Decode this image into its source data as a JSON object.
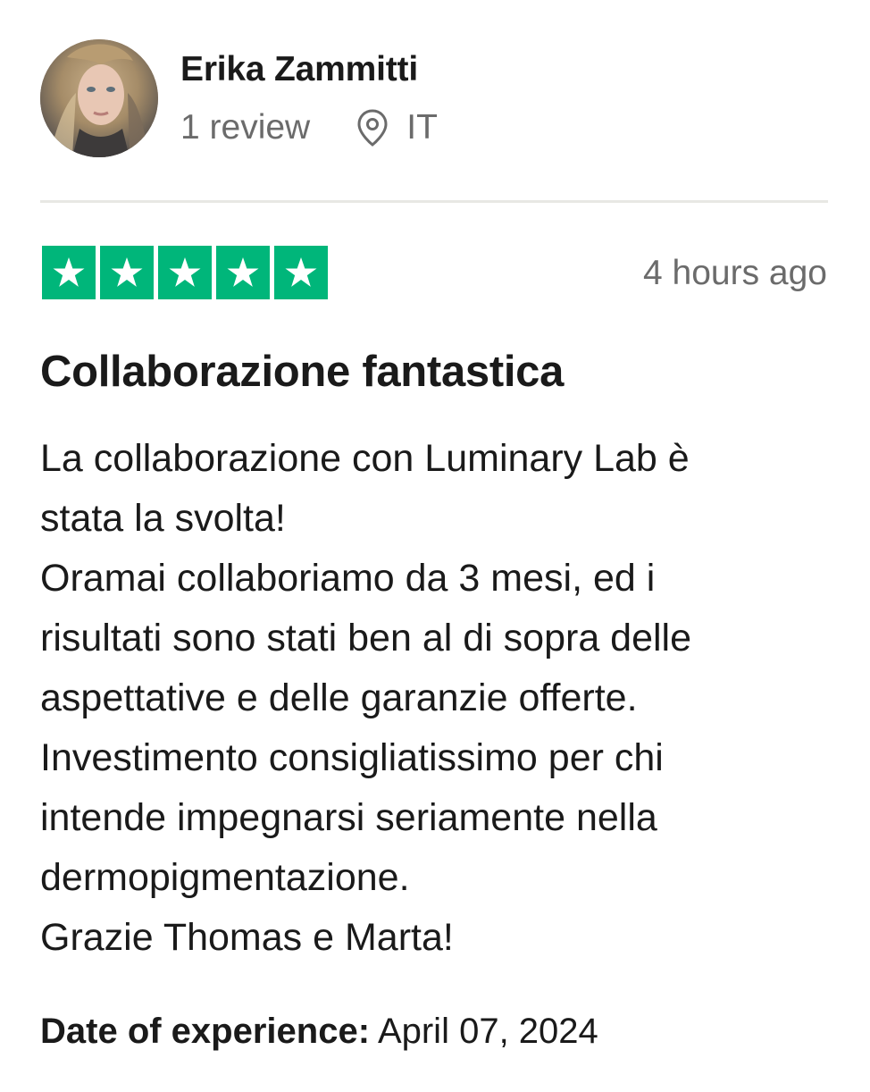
{
  "reviewer": {
    "name": "Erika Zammitti",
    "review_count": "1 review",
    "country": "IT",
    "location_icon": "location-pin-icon",
    "avatar_icon": "user-avatar"
  },
  "review": {
    "rating": 5,
    "max_rating": 5,
    "star_color": "#00b67a",
    "timestamp": "4 hours ago",
    "title": "Collaborazione fantastica",
    "body": "La collaborazione con Luminary Lab è\nstata la svolta!\nOramai collaboriamo da 3 mesi, ed i\nrisultati sono stati ben al di sopra delle\naspettative e delle garanzie offerte.\nInvestimento consigliatissimo per chi\nintende impegnarsi seriamente nella\ndermopigmentazione.\nGrazie Thomas e Marta!",
    "experience_label": "Date of experience:",
    "experience_date": "April 07, 2024"
  }
}
